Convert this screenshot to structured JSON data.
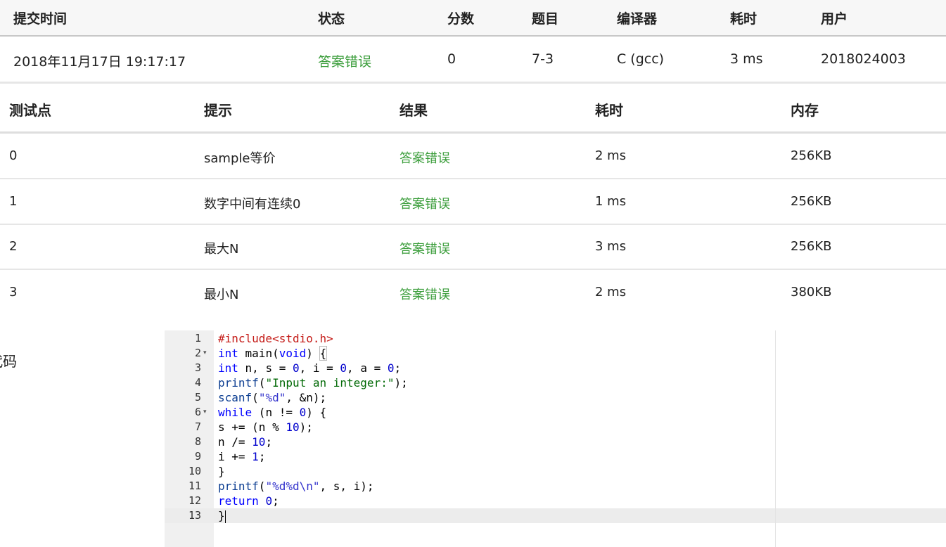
{
  "summary": {
    "headers": [
      "提交时间",
      "状态",
      "分数",
      "题目",
      "编译器",
      "耗时",
      "用户"
    ],
    "row": {
      "time": "2018年11月17日 19:17:17",
      "status": "答案错误",
      "score": "0",
      "problem": "7-3",
      "compiler": "C (gcc)",
      "duration": "3 ms",
      "user": "2018024003"
    }
  },
  "testcases": {
    "headers": [
      "测试点",
      "提示",
      "结果",
      "耗时",
      "内存"
    ],
    "rows": [
      {
        "id": "0",
        "hint": "sample等价",
        "result": "答案错误",
        "time": "2 ms",
        "memory": "256KB"
      },
      {
        "id": "1",
        "hint": "数字中间有连续0",
        "result": "答案错误",
        "time": "1 ms",
        "memory": "256KB"
      },
      {
        "id": "2",
        "hint": "最大N",
        "result": "答案错误",
        "time": "3 ms",
        "memory": "256KB"
      },
      {
        "id": "3",
        "hint": "最小N",
        "result": "答案错误",
        "time": "2 ms",
        "memory": "380KB"
      }
    ]
  },
  "code_label": "代码",
  "editor": {
    "line_numbers": [
      "1",
      "2",
      "3",
      "4",
      "5",
      "6",
      "7",
      "8",
      "9",
      "10",
      "11",
      "12",
      "13"
    ],
    "fold_marker": "▾",
    "lines": [
      "#include<stdio.h>",
      "int main(void) {",
      "int n, s = 0, i = 0, a = 0;",
      "printf(\"Input an integer:\");",
      "scanf(\"%d\", &n);",
      "while (n != 0) {",
      "s += (n % 10);",
      "n /= 10;",
      "i += 1;",
      "}",
      "printf(\"%d%d\\n\", s, i);",
      "return 0;",
      "}"
    ],
    "tokens": {
      "include_kw": "#include",
      "include_file": "<stdio.h>",
      "int": "int",
      "main": " main(",
      "void": "void",
      "while": "while",
      "return": "return",
      "printf": "printf",
      "scanf": "scanf",
      "str_input": "\"Input an integer:\"",
      "fmt_d": "\"%d\"",
      "fmt_dd": "\"%d%d\\n\""
    }
  },
  "colors": {
    "status_wrong": "#3a9d3a",
    "header_bg": "#f7f7f7",
    "gutter_bg": "#f0f0f0"
  }
}
